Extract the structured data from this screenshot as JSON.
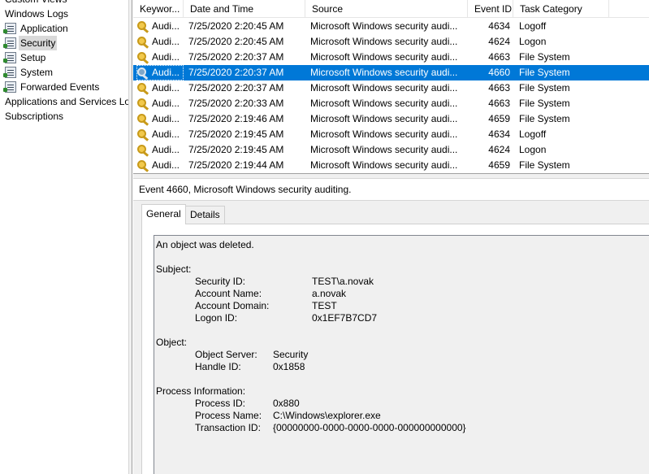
{
  "tree": {
    "custom_views": "Custom Views",
    "windows_logs": "Windows Logs",
    "logs": [
      "Application",
      "Security",
      "Setup",
      "System",
      "Forwarded Events"
    ],
    "apps_services": "Applications and Services Lo",
    "subscriptions": "Subscriptions",
    "selected": "Security"
  },
  "list": {
    "columns": [
      "Keywor...",
      "Date and Time",
      "Source",
      "Event ID",
      "Task Category"
    ],
    "rows": [
      {
        "keyword": "Audi...",
        "date": "7/25/2020 2:20:45 AM",
        "source": "Microsoft Windows security audi...",
        "event_id": "4634",
        "task": "Logoff",
        "icon": "key-icon"
      },
      {
        "keyword": "Audi...",
        "date": "7/25/2020 2:20:45 AM",
        "source": "Microsoft Windows security audi...",
        "event_id": "4624",
        "task": "Logon",
        "icon": "key-icon"
      },
      {
        "keyword": "Audi...",
        "date": "7/25/2020 2:20:37 AM",
        "source": "Microsoft Windows security audi...",
        "event_id": "4663",
        "task": "File System",
        "icon": "key-icon"
      },
      {
        "keyword": "Audi...",
        "date": "7/25/2020 2:20:37 AM",
        "source": "Microsoft Windows security audi...",
        "event_id": "4660",
        "task": "File System",
        "icon": "magnifier-icon",
        "selected": true
      },
      {
        "keyword": "Audi...",
        "date": "7/25/2020 2:20:37 AM",
        "source": "Microsoft Windows security audi...",
        "event_id": "4663",
        "task": "File System",
        "icon": "key-icon"
      },
      {
        "keyword": "Audi...",
        "date": "7/25/2020 2:20:33 AM",
        "source": "Microsoft Windows security audi...",
        "event_id": "4663",
        "task": "File System",
        "icon": "key-icon"
      },
      {
        "keyword": "Audi...",
        "date": "7/25/2020 2:19:46 AM",
        "source": "Microsoft Windows security audi...",
        "event_id": "4659",
        "task": "File System",
        "icon": "key-icon"
      },
      {
        "keyword": "Audi...",
        "date": "7/25/2020 2:19:45 AM",
        "source": "Microsoft Windows security audi...",
        "event_id": "4634",
        "task": "Logoff",
        "icon": "key-icon"
      },
      {
        "keyword": "Audi...",
        "date": "7/25/2020 2:19:45 AM",
        "source": "Microsoft Windows security audi...",
        "event_id": "4624",
        "task": "Logon",
        "icon": "key-icon"
      },
      {
        "keyword": "Audi...",
        "date": "7/25/2020 2:19:44 AM",
        "source": "Microsoft Windows security audi...",
        "event_id": "4659",
        "task": "File System",
        "icon": "key-icon"
      }
    ]
  },
  "detail": {
    "title": "Event 4660, Microsoft Windows security auditing.",
    "tabs": [
      "General",
      "Details"
    ],
    "active_tab": "General",
    "description": {
      "headline": "An object was deleted.",
      "subject_header": "Subject:",
      "security_id_label": "Security ID:",
      "security_id": "TEST\\a.novak",
      "account_name_label": "Account Name:",
      "account_name": "a.novak",
      "account_domain_label": "Account Domain:",
      "account_domain": "TEST",
      "logon_id_label": "Logon ID:",
      "logon_id": "0x1EF7B7CD7",
      "object_header": "Object:",
      "object_server_label": "Object Server:",
      "object_server": "Security",
      "handle_id_label": "Handle ID:",
      "handle_id": "0x1858",
      "process_header": "Process Information:",
      "process_id_label": "Process ID:",
      "process_id": "0x880",
      "process_name_label": "Process Name:",
      "process_name": "C:\\Windows\\explorer.exe",
      "transaction_id_label": "Transaction ID:",
      "transaction_id": "{00000000-0000-0000-0000-000000000000}"
    }
  },
  "colors": {
    "selection": "#0078d7",
    "tree_selection": "#d9d9d9"
  }
}
